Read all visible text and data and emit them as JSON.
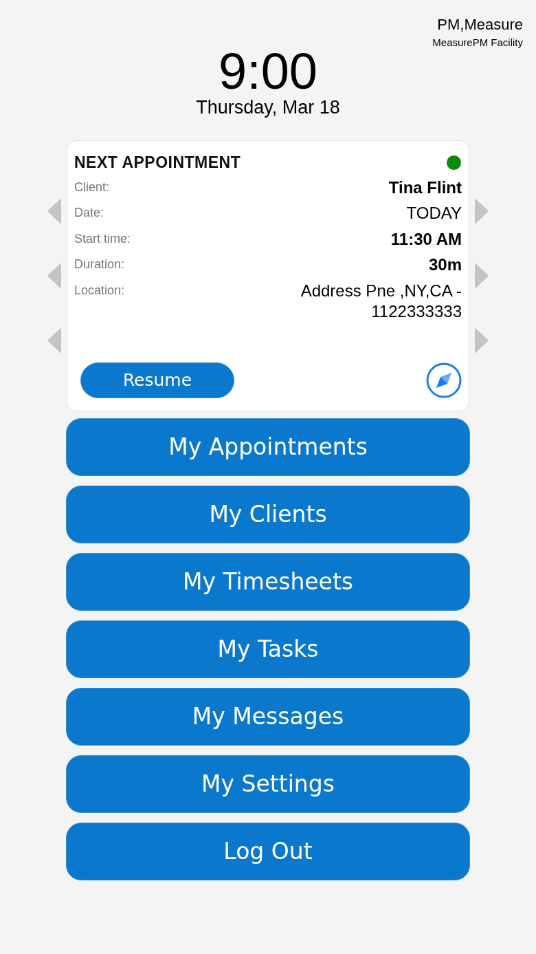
{
  "user": {
    "name": "PM,Measure",
    "facility": "MeasurePM Facility"
  },
  "clock": {
    "time": "9:00",
    "date": "Thursday, Mar 18"
  },
  "appointment": {
    "title": "NEXT APPOINTMENT",
    "status": {
      "color": "#0a8a0a"
    },
    "fields": [
      {
        "label": "Client:",
        "value": "Tina Flint",
        "bold": true
      },
      {
        "label": "Date:",
        "value": "TODAY",
        "bold": false
      },
      {
        "label": "Start time:",
        "value": "11:30 AM",
        "bold": true
      },
      {
        "label": "Duration:",
        "value": "30m",
        "bold": true
      },
      {
        "label": "Location:",
        "value": "Address Pne ,NY,CA - 1122333333",
        "bold": false
      }
    ],
    "action": "Resume"
  },
  "menu": [
    "My Appointments",
    "My Clients",
    "My Timesheets",
    "My Tasks",
    "My Messages",
    "My Settings",
    "Log Out"
  ]
}
